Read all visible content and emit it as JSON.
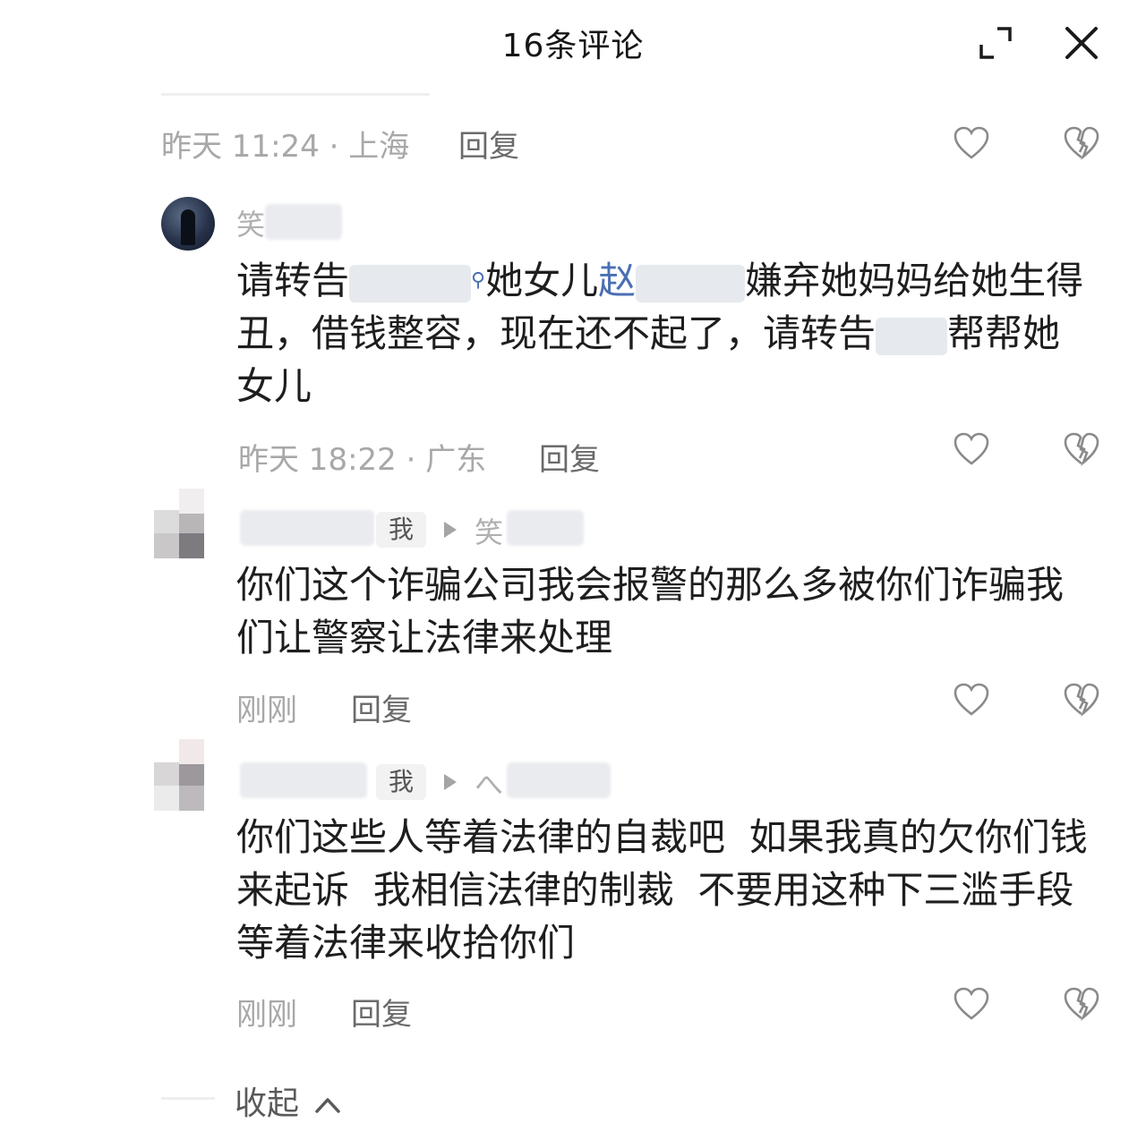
{
  "header": {
    "title": "16条评论"
  },
  "comments": [
    {
      "meta": "昨天 11:24 · 上海",
      "reply": "回复"
    },
    {
      "username": "笑",
      "text_parts": [
        "请转告",
        "她女儿",
        "赵",
        "嫌弃她妈妈给她生得丑，借钱整容，现在还不起了，请转告",
        "帮帮她女儿"
      ],
      "meta": "昨天 18:22 · 广东",
      "reply": "回复"
    },
    {
      "badge": "我",
      "reply_to": "笑",
      "text": "你们这个诈骗公司我会报警的那么多被你们诈骗我们让警察让法律来处理",
      "meta": "刚刚",
      "reply": "回复"
    },
    {
      "badge": "我",
      "reply_to": "へ",
      "text": "你们这些人等着法律的自裁吧  如果我真的欠你们钱来起诉  我相信法律的制裁  不要用这种下三滥手段  等着法律来收拾你们",
      "meta": "刚刚",
      "reply": "回复"
    }
  ],
  "footer": {
    "collapse_label": "收起",
    "collapse_icon": "chevron-up"
  },
  "colors": {
    "link_blue": "#4a6fb3",
    "meta_gray": "#a8a8a8",
    "text": "#1e1e1e"
  }
}
